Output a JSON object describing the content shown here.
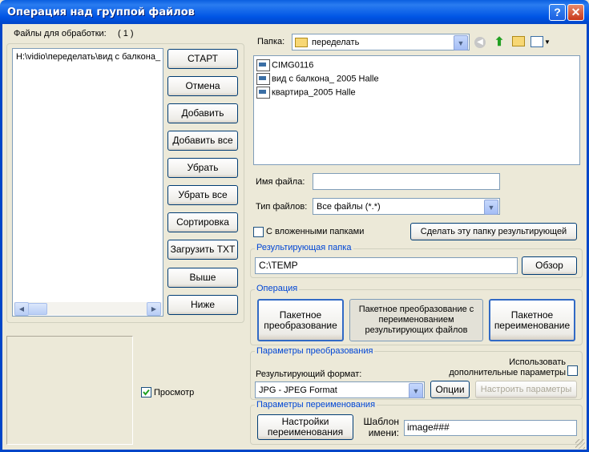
{
  "window": {
    "title": "Операция над группой файлов",
    "help_glyph": "?",
    "close_glyph": "✕"
  },
  "left": {
    "files_label": "Файлы для обработки:",
    "files_count": "( 1 )",
    "files": [
      "H:\\vidio\\переделать\\вид с балкона_"
    ],
    "buttons": {
      "start": "СТАРТ",
      "cancel": "Отмена",
      "add": "Добавить",
      "add_all": "Добавить все",
      "remove": "Убрать",
      "remove_all": "Убрать все",
      "sort": "Сортировка",
      "load_txt": "Загрузить TXT",
      "up": "Выше",
      "down": "Ниже"
    },
    "preview_label": "Просмотр",
    "preview_checked": true
  },
  "browser": {
    "folder_label": "Папка:",
    "folder_value": "переделать",
    "files": [
      "CIMG0116",
      "вид с балкона_ 2005 Halle",
      "квартира_2005 Halle"
    ],
    "filename_label": "Имя файла:",
    "filename_value": "",
    "filetype_label": "Тип файлов:",
    "filetype_value": "Все файлы (*.*)",
    "subfolders_label": "С вложенными папками",
    "subfolders_checked": false,
    "make_result_folder": "Сделать эту папку результирующей"
  },
  "result_folder": {
    "title": "Результирующая папка",
    "value": "C:\\TEMP",
    "browse": "Обзор"
  },
  "operation": {
    "title": "Операция",
    "batch_convert": "Пакетное преобразование",
    "batch_convert_rename": "Пакетное преобразование с переименованием результирующих файлов",
    "batch_rename": "Пакетное переименование"
  },
  "convert_params": {
    "title": "Параметры преобразования",
    "use_extra": "Использовать дополнительные параметры",
    "use_extra_checked": false,
    "format_label": "Результирующий формат:",
    "format_value": "JPG - JPEG Format",
    "options": "Опции",
    "configure": "Настроить параметры"
  },
  "rename_params": {
    "title": "Параметры переименования",
    "settings": "Настройки переименования",
    "template_label": "Шаблон имени:",
    "template_value": "image###"
  },
  "colors": {
    "titlebar": "#0055e5",
    "group_title": "#0046d5",
    "window_bg": "#ece9d8"
  }
}
